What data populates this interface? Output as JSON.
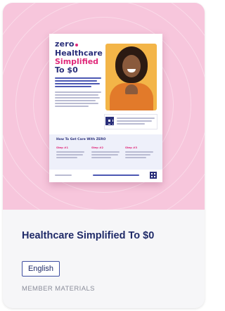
{
  "card": {
    "title": "Healthcare Simplified To $0",
    "language_button": "English",
    "category": "MEMBER MATERIALS"
  },
  "thumbnail": {
    "logo": "zero",
    "headline_line1": "Healthcare",
    "headline_line2": "Simplified",
    "headline_line3": "To $0",
    "section_title": "How To Get Care With ZERO",
    "steps": [
      "Step #1",
      "Step #2",
      "Step #3"
    ]
  },
  "colors": {
    "hero_background": "#f7c6dc",
    "brand_navy": "#1f2a68",
    "brand_pink": "#e0297a",
    "button_border": "#3f4fa1",
    "category_text": "#8a8d9a"
  },
  "icons": {
    "person_photo": "smiling-woman-heart-hands",
    "qr_code": "qr-code-icon"
  }
}
